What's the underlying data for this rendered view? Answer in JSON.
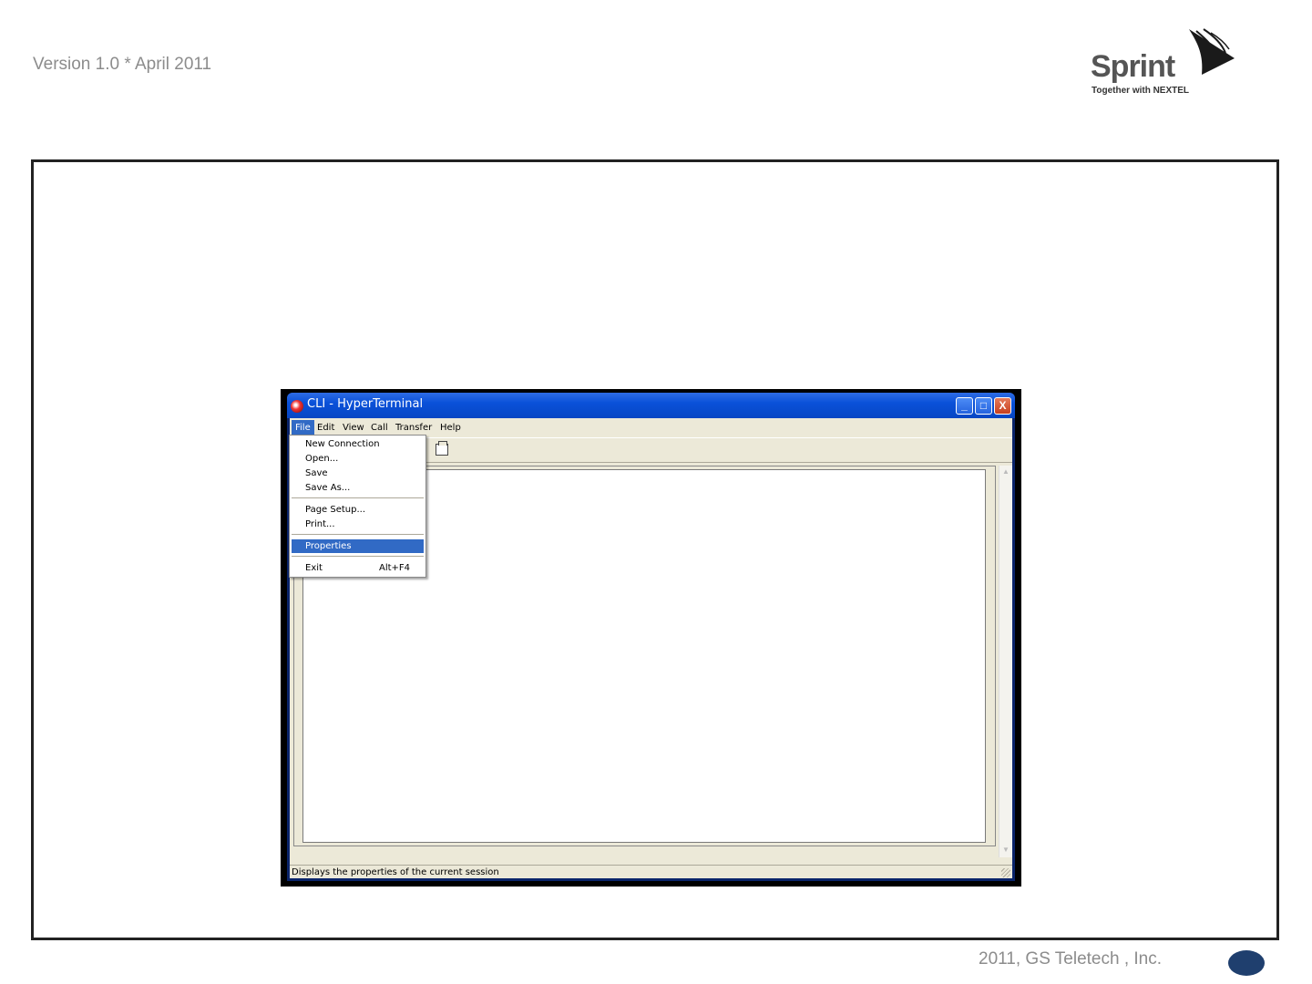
{
  "slide": {
    "version": "Version 1.0 * April 2011",
    "footer": "2011, GS Teletech , Inc."
  },
  "logo": {
    "brand": "Sprint",
    "tagline": "Together with NEXTEL"
  },
  "window": {
    "title": "CLI - HyperTerminal",
    "buttons": {
      "minimize": "_",
      "maximize": "□",
      "close": "X"
    },
    "menu": [
      "File",
      "Edit",
      "View",
      "Call",
      "Transfer",
      "Help"
    ],
    "active_menu": "File",
    "status": "Displays the properties of the current session"
  },
  "file_menu": {
    "items": [
      {
        "label": "New Connection",
        "shortcut": ""
      },
      {
        "label": "Open...",
        "shortcut": ""
      },
      {
        "label": "Save",
        "shortcut": ""
      },
      {
        "label": "Save As...",
        "shortcut": ""
      },
      {
        "label": "Page Setup...",
        "shortcut": ""
      },
      {
        "label": "Print...",
        "shortcut": ""
      },
      {
        "label": "Properties",
        "shortcut": "",
        "highlighted": true
      },
      {
        "label": "Exit",
        "shortcut": "Alt+F4"
      }
    ]
  },
  "colors": {
    "titlebar": "#0a51d9",
    "highlight": "#316ac5",
    "page_oval": "#1f3f6e"
  }
}
